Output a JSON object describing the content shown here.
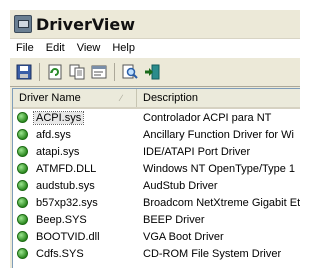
{
  "app": {
    "title": "DriverView"
  },
  "menu": [
    "File",
    "Edit",
    "View",
    "Help"
  ],
  "toolbar": {
    "buttons": [
      "save-icon",
      "refresh-icon",
      "copy-icon",
      "properties-icon",
      "find-icon",
      "exit-icon"
    ]
  },
  "columns": {
    "name": "Driver Name",
    "description": "Description"
  },
  "rows": [
    {
      "name": "ACPI.sys",
      "description": "Controlador ACPI para NT",
      "status": "running"
    },
    {
      "name": "afd.sys",
      "description": "Ancillary Function Driver for Wi",
      "status": "running"
    },
    {
      "name": "atapi.sys",
      "description": "IDE/ATAPI Port Driver",
      "status": "running"
    },
    {
      "name": "ATMFD.DLL",
      "description": "Windows NT OpenType/Type 1",
      "status": "running"
    },
    {
      "name": "audstub.sys",
      "description": "AudStub Driver",
      "status": "running"
    },
    {
      "name": "b57xp32.sys",
      "description": "Broadcom NetXtreme Gigabit Et",
      "status": "running"
    },
    {
      "name": "Beep.SYS",
      "description": "BEEP Driver",
      "status": "running"
    },
    {
      "name": "BOOTVID.dll",
      "description": "VGA Boot Driver",
      "status": "running"
    },
    {
      "name": "Cdfs.SYS",
      "description": "CD-ROM File System Driver",
      "status": "running"
    }
  ],
  "colors": {
    "status_running": "#2e8b22",
    "selection": "#e8e8e8"
  }
}
